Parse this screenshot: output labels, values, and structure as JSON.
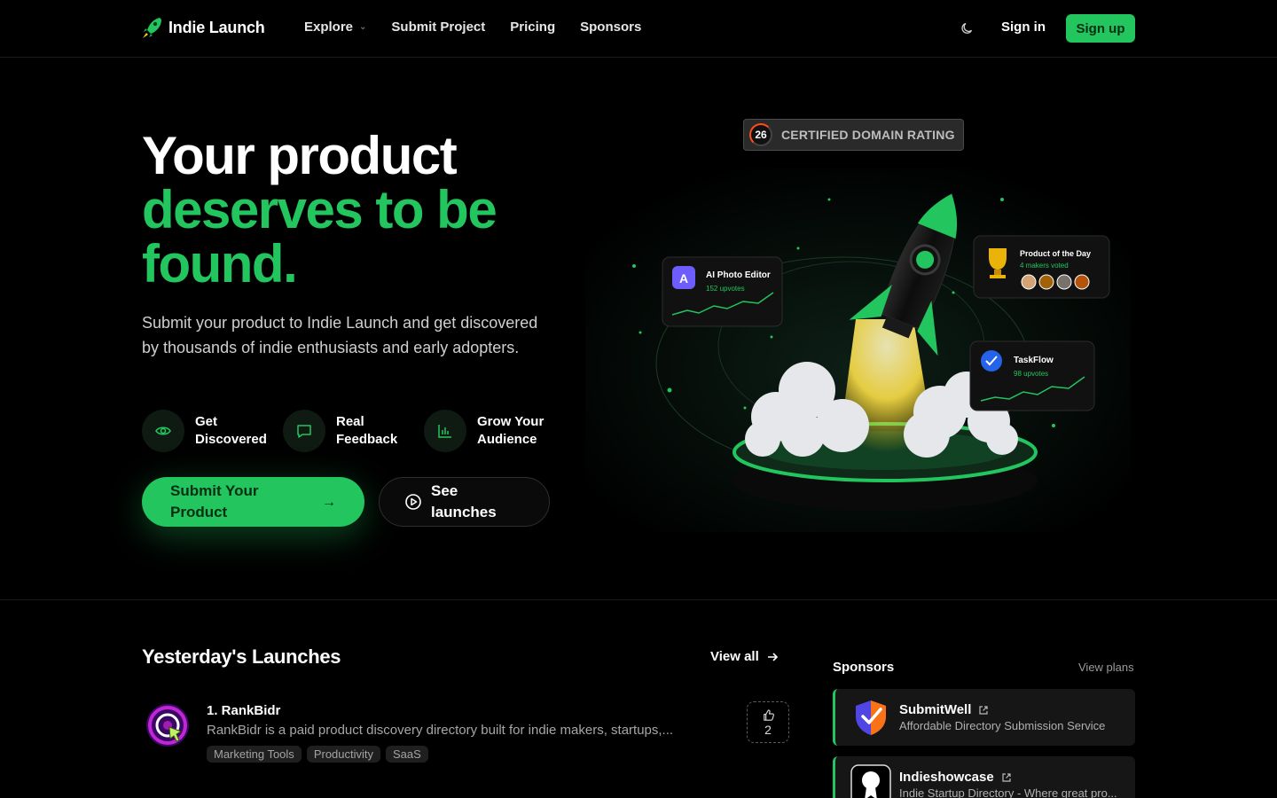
{
  "nav": {
    "brand": "Indie Launch",
    "links": [
      "Explore",
      "Submit Project",
      "Pricing",
      "Sponsors"
    ],
    "sign_in": "Sign in",
    "sign_up": "Sign up"
  },
  "hero": {
    "title_line1": "Your product",
    "title_line2": "deserves to be",
    "title_line3": "found.",
    "subtitle": "Submit your product to Indie Launch and get discovered by thousands of indie enthusiasts and early adopters.",
    "features": [
      "Get Discovered",
      "Real Feedback",
      "Grow Your Audience"
    ],
    "cta_primary": "Submit Your Product",
    "cta_primary_arrow": "→",
    "cta_secondary": "See launches",
    "badge_number": "26",
    "badge_text": "CERTIFIED DOMAIN RATING",
    "art": {
      "card1_title": "AI Photo Editor",
      "card1_sub": "152 upvotes",
      "card1_letter": "A",
      "card2_title": "Product of the Day",
      "card2_sub": "4 makers voted",
      "card3_title": "TaskFlow",
      "card3_sub": "98 upvotes"
    }
  },
  "launches": {
    "title": "Yesterday's Launches",
    "view_all": "View all",
    "items": [
      {
        "name": "1. RankBidr",
        "description": "RankBidr is a paid product discovery directory built for indie makers, startups,...",
        "tags": [
          "Marketing Tools",
          "Productivity",
          "SaaS"
        ],
        "votes": "2"
      }
    ]
  },
  "sponsors": {
    "title": "Sponsors",
    "view_plans": "View plans",
    "items": [
      {
        "name": "SubmitWell",
        "description": "Affordable Directory Submission Service"
      },
      {
        "name": "Indieshowcase",
        "description": "Indie Startup Directory - Where great pro..."
      }
    ]
  },
  "colors": {
    "accent": "#22c55e",
    "background": "#000000",
    "muted_text": "#a6a6a6"
  }
}
